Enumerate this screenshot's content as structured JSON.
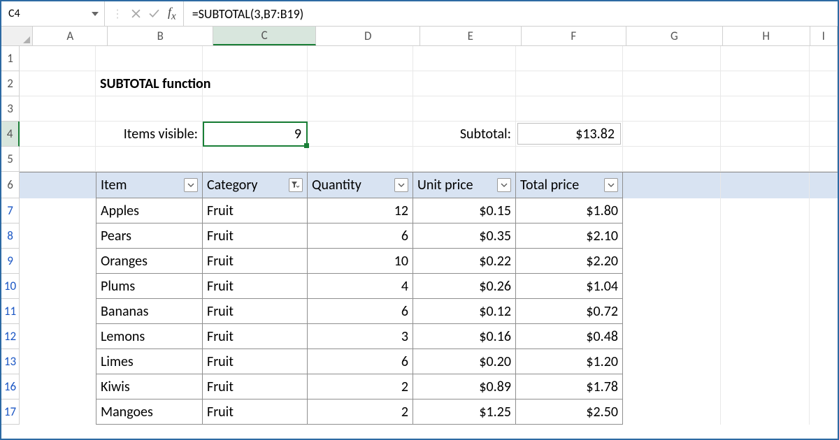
{
  "name_box": "C4",
  "formula": "=SUBTOTAL(3,B7:B19)",
  "columns": [
    "A",
    "B",
    "C",
    "D",
    "E",
    "F",
    "G",
    "H",
    "I"
  ],
  "active_column": "C",
  "rows": [
    "1",
    "2",
    "3",
    "4",
    "5",
    "6",
    "7",
    "8",
    "9",
    "10",
    "11",
    "12",
    "13",
    "16",
    "17"
  ],
  "active_row": "4",
  "filtered_rows": [
    "7",
    "8",
    "9",
    "10",
    "11",
    "12",
    "13",
    "16",
    "17"
  ],
  "title": "SUBTOTAL function",
  "items_visible_label": "Items visible:",
  "items_visible_value": "9",
  "subtotal_label": "Subtotal:",
  "subtotal_value": "$13.82",
  "headers": {
    "item": "Item",
    "category": "Category",
    "quantity": "Quantity",
    "unit_price": "Unit price",
    "total_price": "Total price"
  },
  "data": [
    {
      "item": "Apples",
      "category": "Fruit",
      "quantity": "12",
      "unit": "$0.15",
      "total": "$1.80"
    },
    {
      "item": "Pears",
      "category": "Fruit",
      "quantity": "6",
      "unit": "$0.35",
      "total": "$2.10"
    },
    {
      "item": "Oranges",
      "category": "Fruit",
      "quantity": "10",
      "unit": "$0.22",
      "total": "$2.20"
    },
    {
      "item": "Plums",
      "category": "Fruit",
      "quantity": "4",
      "unit": "$0.26",
      "total": "$1.04"
    },
    {
      "item": "Bananas",
      "category": "Fruit",
      "quantity": "6",
      "unit": "$0.12",
      "total": "$0.72"
    },
    {
      "item": "Lemons",
      "category": "Fruit",
      "quantity": "3",
      "unit": "$0.16",
      "total": "$0.48"
    },
    {
      "item": "Limes",
      "category": "Fruit",
      "quantity": "6",
      "unit": "$0.20",
      "total": "$1.20"
    },
    {
      "item": "Kiwis",
      "category": "Fruit",
      "quantity": "2",
      "unit": "$0.89",
      "total": "$1.78"
    },
    {
      "item": "Mangoes",
      "category": "Fruit",
      "quantity": "2",
      "unit": "$1.25",
      "total": "$2.50"
    }
  ]
}
